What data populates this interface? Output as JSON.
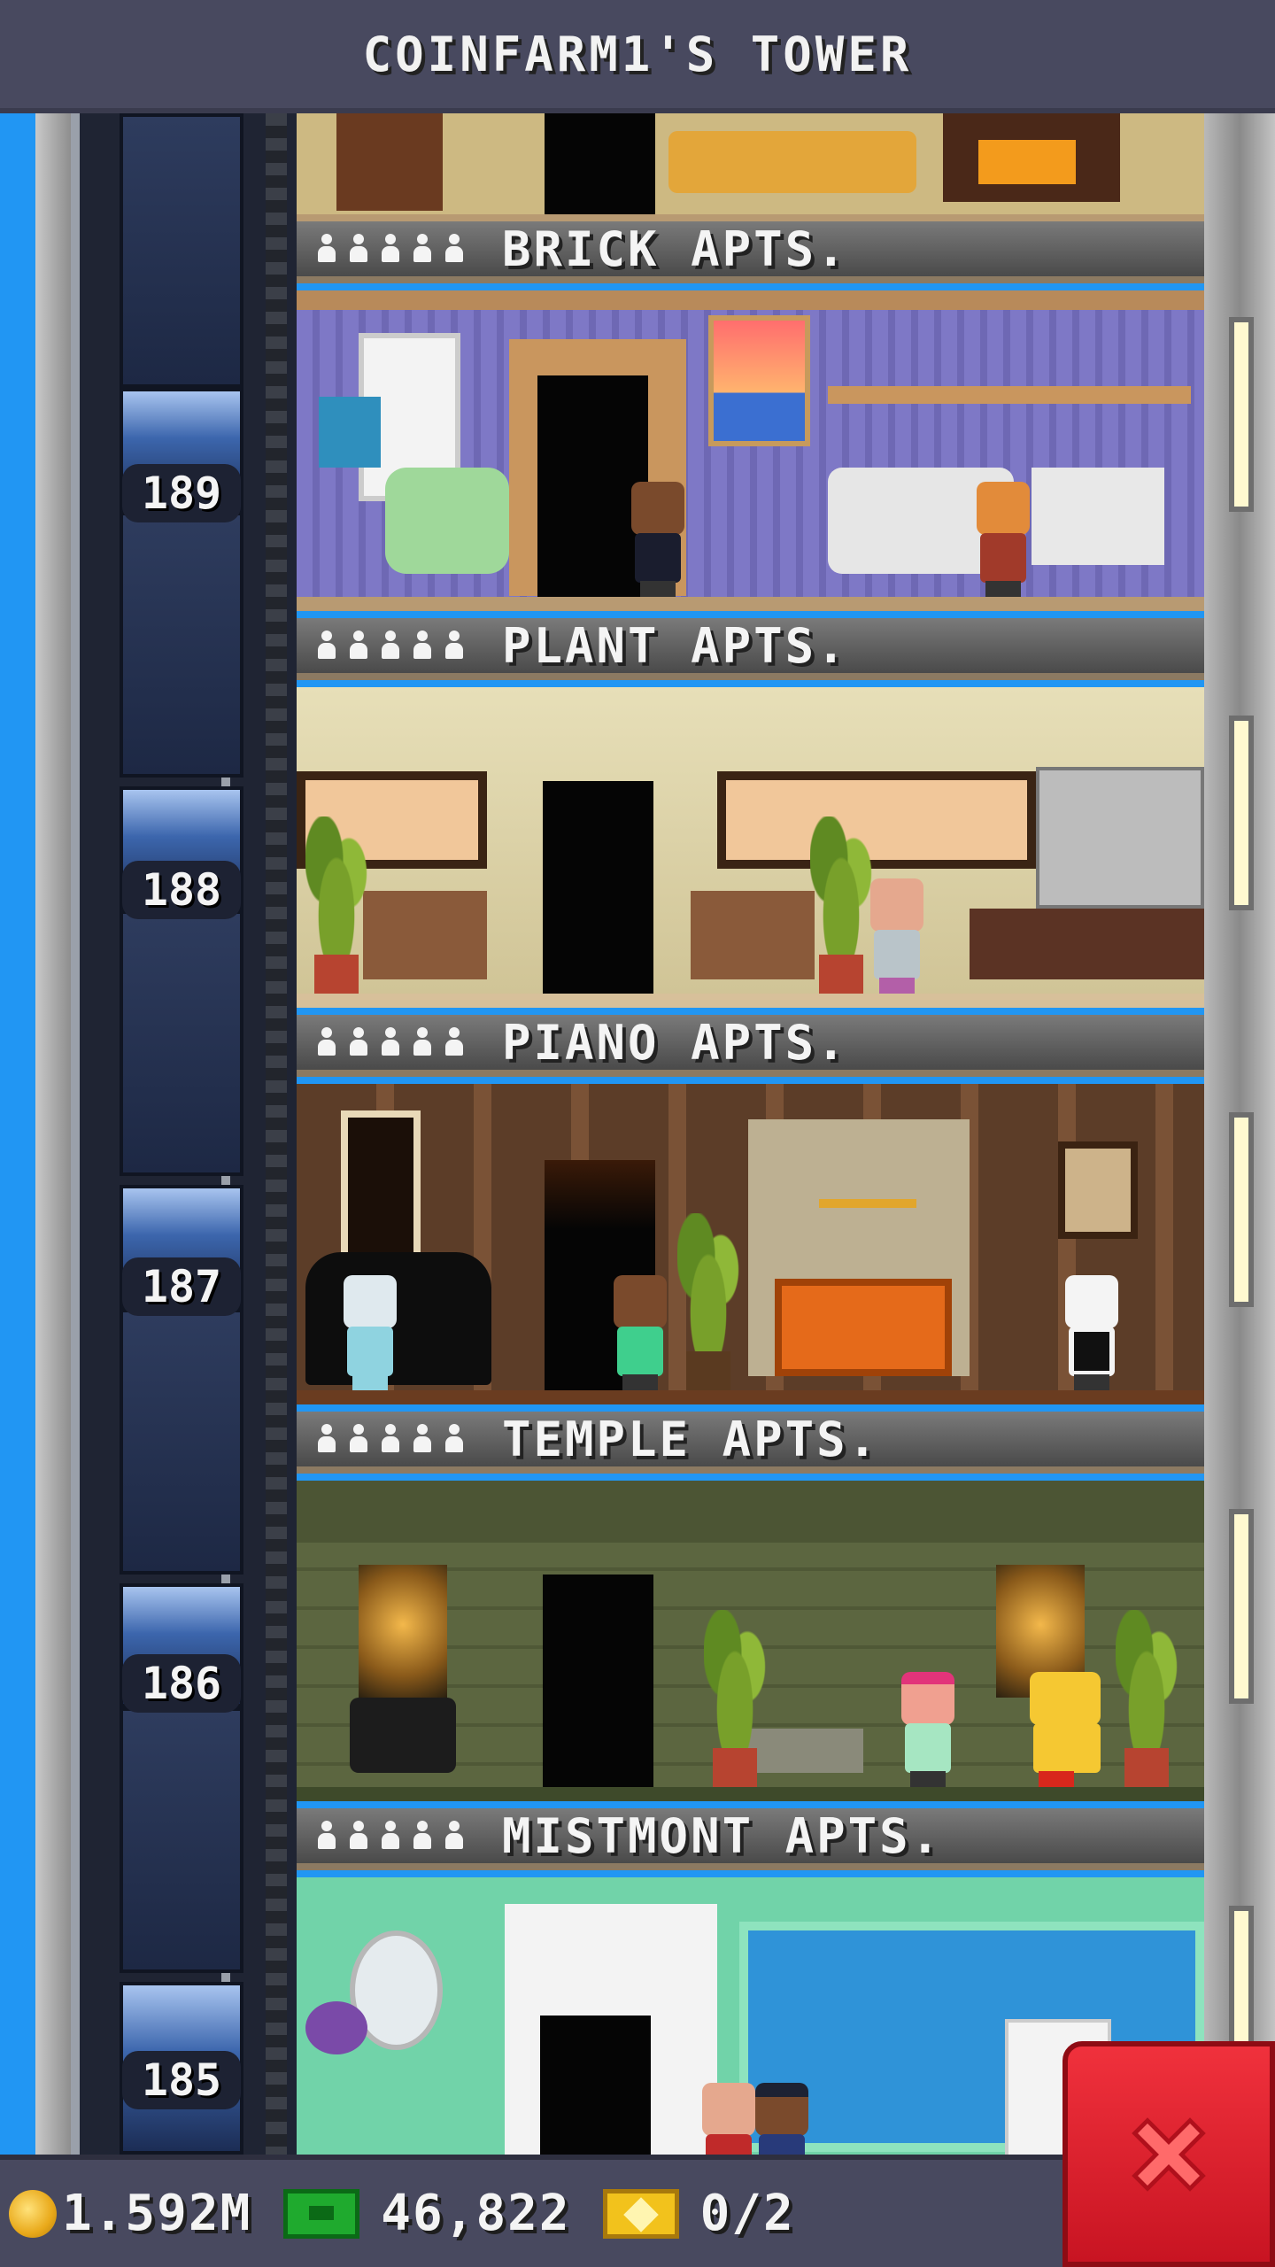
{
  "header": {
    "title": "COINFARM1'S TOWER"
  },
  "floors": [
    {
      "number": "189",
      "name": "BRICK APTS."
    },
    {
      "number": "188",
      "name": "PLANT APTS."
    },
    {
      "number": "187",
      "name": "PIANO APTS."
    },
    {
      "number": "186",
      "name": "TEMPLE APTS."
    },
    {
      "number": "185",
      "name": "MISTMONT APTS."
    }
  ],
  "footer": {
    "coins": "1.592M",
    "bux": "46,822",
    "tickets": "0/2"
  },
  "colors": {
    "header_bg": "#48495f",
    "close_button": "#e02430",
    "brick_wall": "#7c76c2",
    "plant_wall": "#d9cfa4",
    "piano_wall": "#6a4a30",
    "temple_wall": "#5f6a3e",
    "mistmont_wall": "#6fd0a6"
  },
  "icons": {
    "coin": "coin-icon",
    "bux": "bux-icon",
    "ticket": "vip-ticket-icon",
    "close": "close-icon",
    "occupant": "person-icon"
  }
}
